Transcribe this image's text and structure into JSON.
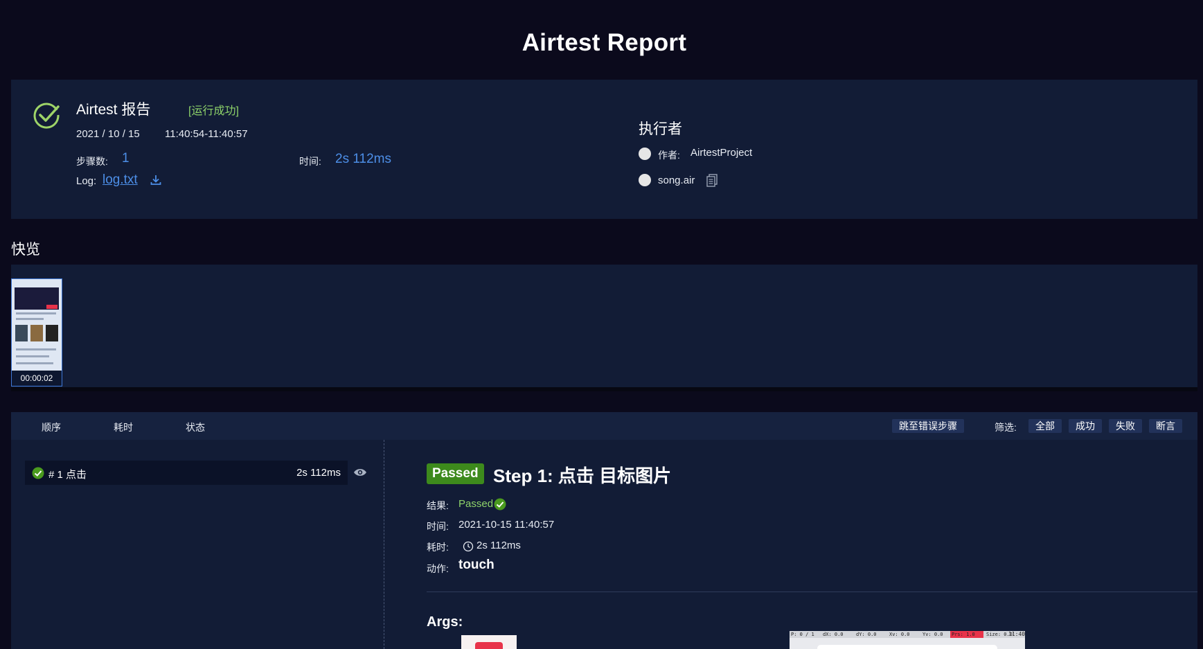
{
  "page": {
    "title": "Airtest Report"
  },
  "summary": {
    "name": "Airtest 报告",
    "status": "[运行成功]",
    "date": "2021 / 10 / 15",
    "time_range": "11:40:54-11:40:57",
    "steps_label": "步骤数:",
    "steps_value": "1",
    "duration_label": "时间:",
    "duration_value": "2s 112ms",
    "log_label": "Log:",
    "log_link": "log.txt",
    "status_color": "#8ed36a",
    "link_color": "#4d8fe8"
  },
  "executor": {
    "title": "执行者",
    "author_label": "作者:",
    "author_value": "AirtestProject",
    "script": "song.air"
  },
  "overview": {
    "title": "快览",
    "thumbnails": [
      {
        "time": "00:00:02"
      }
    ]
  },
  "toolbar": {
    "col_order": "顺序",
    "col_duration": "耗时",
    "col_status": "状态",
    "jump_error": "跳至错误步骤",
    "filter_label": "筛选:",
    "filter_all": "全部",
    "filter_success": "成功",
    "filter_fail": "失败",
    "filter_assert": "断言"
  },
  "steps": [
    {
      "label": "# 1 点击",
      "duration": "2s 112ms",
      "status": "passed"
    }
  ],
  "detail": {
    "badge": "Passed",
    "title": "Step 1: 点击 目标图片",
    "result_label": "结果:",
    "result_value": "Passed",
    "time_label": "时间:",
    "time_value": "2021-10-15 11:40:57",
    "duration_label": "耗时:",
    "duration_value": "2s 112ms",
    "action_label": "动作:",
    "action_value": "touch",
    "args_title": "Args:",
    "badge_color": "#3d8a1c"
  },
  "screenshot_overlay": {
    "p": "P: 0 / 1",
    "dx": "dX: 0.0",
    "dy": "dY: 0.0",
    "xv": "Xv: 0.0",
    "yv": "Yv: 0.0",
    "prs": "Prs: 1.0",
    "size": "Size: 0.0",
    "clock": "11:40"
  }
}
